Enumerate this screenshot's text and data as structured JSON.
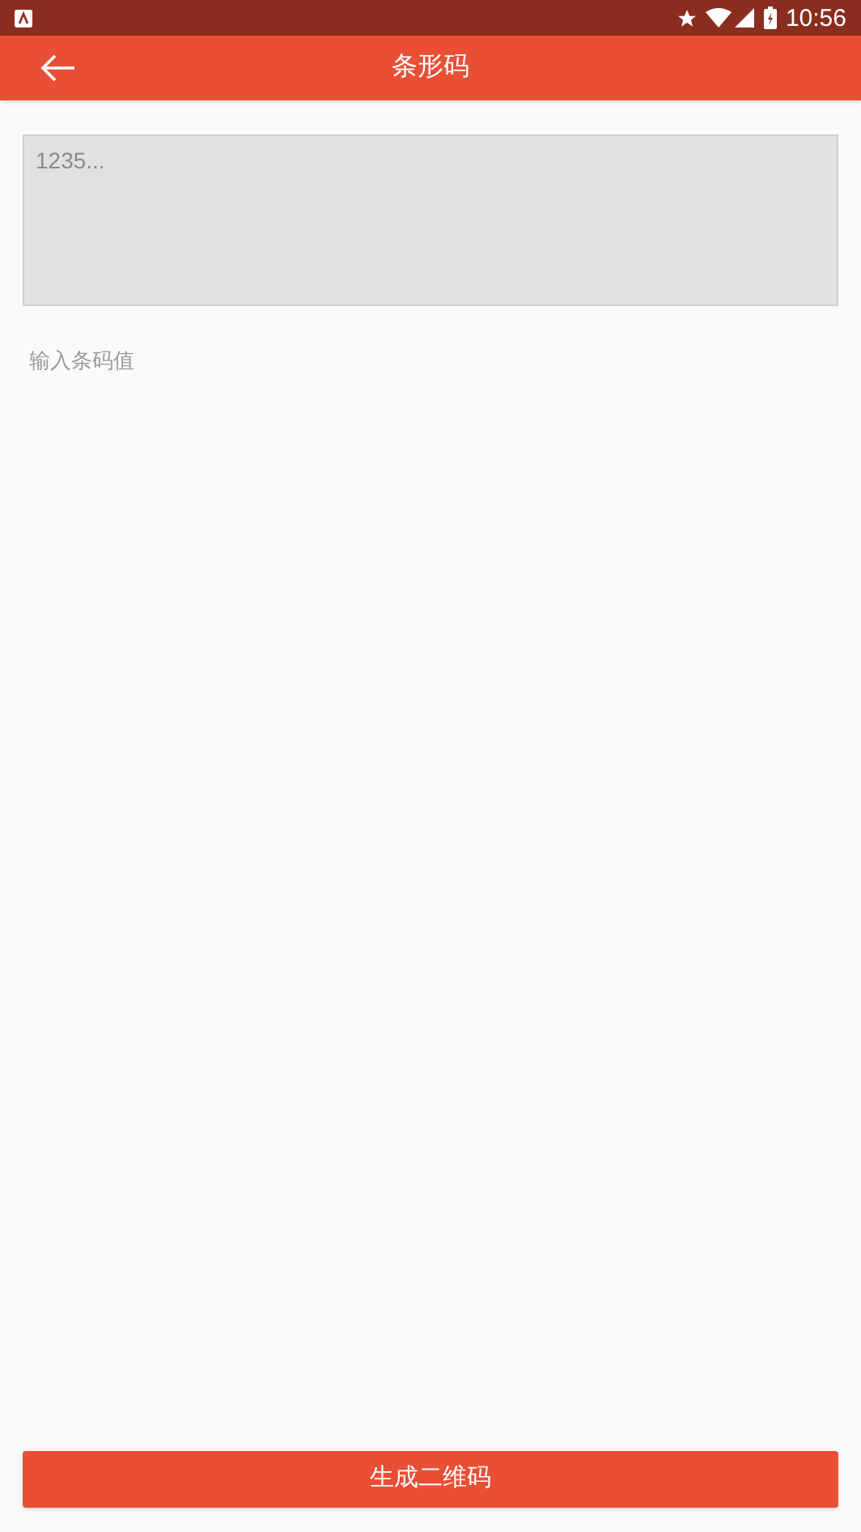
{
  "status_bar": {
    "time": "10:56"
  },
  "app_bar": {
    "title": "条形码"
  },
  "barcode_field": {
    "placeholder": "1235...",
    "hint": "输入条码值"
  },
  "generate_button": {
    "label": "生成二维码"
  }
}
